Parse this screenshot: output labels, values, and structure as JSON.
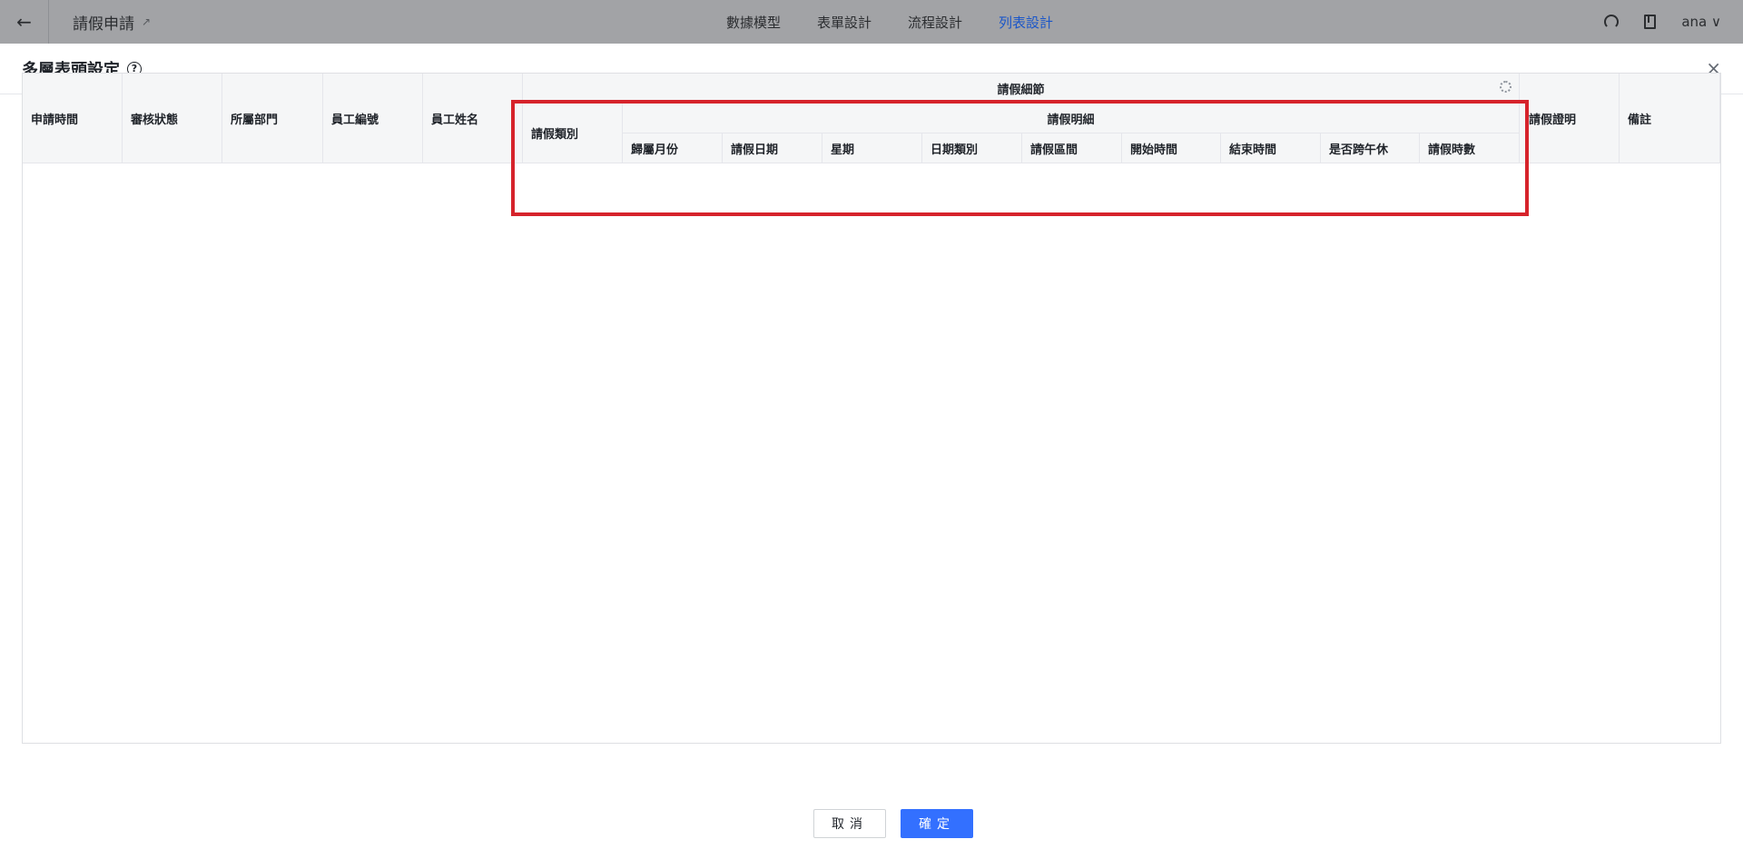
{
  "topbar": {
    "back_icon": "arrow-left-icon",
    "app_title": "請假申請",
    "tabs": [
      "數據模型",
      "表單設計",
      "流程設計",
      "列表設計"
    ],
    "active_tab": "列表設計",
    "user": "ana ∨"
  },
  "modal": {
    "title": "多層表頭設定",
    "help": "?",
    "close": "×"
  },
  "table": {
    "left_columns": [
      "申請時間",
      "審核狀態",
      "所屬部門",
      "員工編號",
      "員工姓名"
    ],
    "group_title": "請假細節",
    "group_first_col": "請假類別",
    "subgroup_title": "請假明細",
    "subgroup_columns": [
      "歸屬月份",
      "請假日期",
      "星期",
      "日期類別",
      "請假區間",
      "開始時間",
      "結束時間",
      "是否跨午休",
      "請假時數"
    ],
    "right_columns": [
      "請假證明",
      "備註"
    ]
  },
  "footer": {
    "cancel": "取消",
    "ok": "確定"
  },
  "colors": {
    "highlight_border": "#d6232b",
    "primary": "#3370ff",
    "active_tab": "#1a56c9"
  }
}
